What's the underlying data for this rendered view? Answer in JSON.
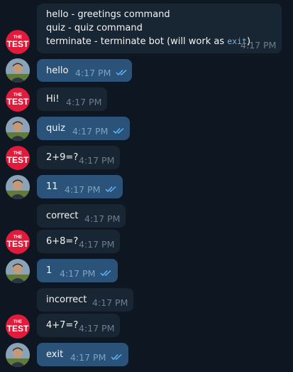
{
  "colors": {
    "background": "#0e1621",
    "incoming_bubble": "#182533",
    "outgoing_bubble": "#2b5278",
    "bot_avatar": "#e01b3c",
    "read_checks": "#5eb5f7"
  },
  "bot": {
    "avatar_top": "THE",
    "avatar_bottom": "TEST"
  },
  "messages": [
    {
      "from": "bot",
      "lines": [
        "hello - greetings command",
        "quiz - quiz command",
        "terminate - terminate bot (will work as "
      ],
      "code": "exit",
      "code_close": ")",
      "time": "4:17 PM"
    },
    {
      "from": "user",
      "text": "hello",
      "time": "4:17 PM",
      "status": "read"
    },
    {
      "from": "bot",
      "text": "Hi!",
      "time": "4:17 PM"
    },
    {
      "from": "user",
      "text": "quiz",
      "time": "4:17 PM",
      "status": "read"
    },
    {
      "from": "bot",
      "text": "2+9=?",
      "time": "4:17 PM"
    },
    {
      "from": "user",
      "text": "11",
      "time": "4:17 PM",
      "status": "read"
    },
    {
      "from": "bot",
      "text": "correct",
      "time": "4:17 PM"
    },
    {
      "from": "bot",
      "text": "6+8=?",
      "time": "4:17 PM"
    },
    {
      "from": "user",
      "text": "1",
      "time": "4:17 PM",
      "status": "read"
    },
    {
      "from": "bot",
      "text": "incorrect",
      "time": "4:17 PM"
    },
    {
      "from": "bot",
      "text": "4+7=?",
      "time": "4:17 PM"
    },
    {
      "from": "user",
      "text": "exit",
      "time": "4:17 PM",
      "status": "read"
    }
  ]
}
